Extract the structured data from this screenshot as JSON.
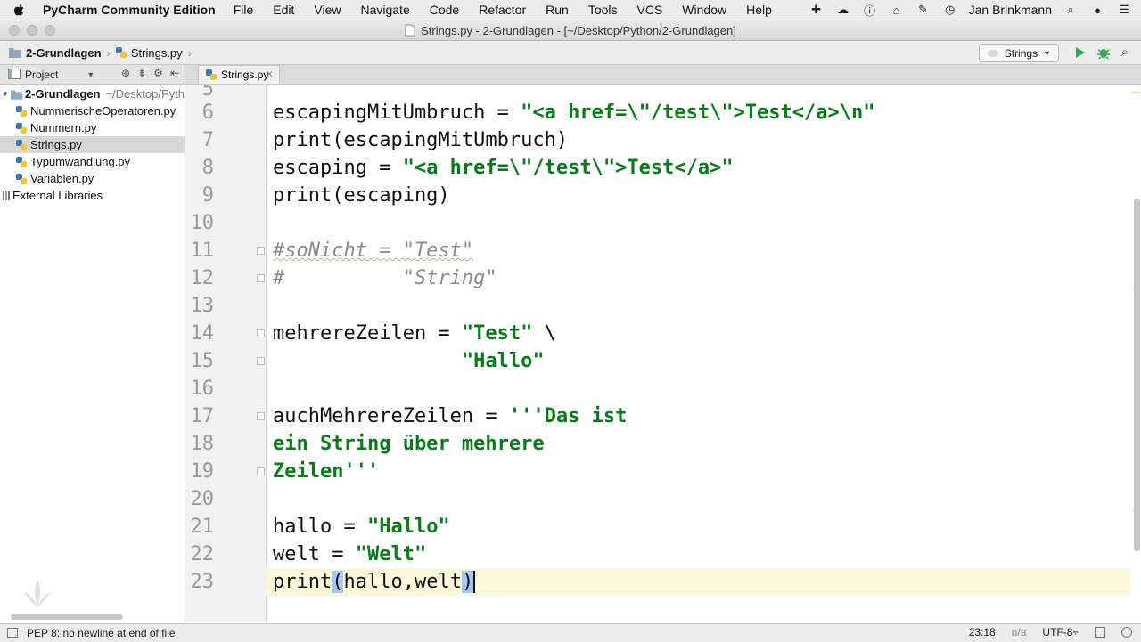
{
  "menubar": {
    "app_name": "PyCharm Community Edition",
    "menus": [
      "File",
      "Edit",
      "View",
      "Navigate",
      "Code",
      "Refactor",
      "Run",
      "Tools",
      "VCS",
      "Window",
      "Help"
    ],
    "user": "Jan Brinkmann"
  },
  "window": {
    "title": "Strings.py - 2-Grundlagen - [~/Desktop/Python/2-Grundlagen]"
  },
  "navbar": {
    "breadcrumbs": [
      "2-Grundlagen",
      "Strings.py"
    ],
    "run_config": "Strings"
  },
  "project_panel": {
    "label": "Project",
    "root": "2-Grundlagen",
    "root_path": "~/Desktop/Pyth",
    "files": [
      "NummerischeOperatoren.py",
      "Nummern.py",
      "Strings.py",
      "Typumwandlung.py",
      "Variablen.py"
    ],
    "external": "External Libraries"
  },
  "editor": {
    "tab_label": "Strings.py",
    "partial_line_number": "5",
    "lines": [
      {
        "n": "6",
        "a": "escapingMitUmbruch = ",
        "s": "\"<a href=\\\"/test\\\">Test</a>\\n\""
      },
      {
        "n": "7",
        "a": "print(escapingMitUmbruch)"
      },
      {
        "n": "8",
        "a": "escaping = ",
        "s": "\"<a href=\\\"/test\\\">Test</a>\""
      },
      {
        "n": "9",
        "a": "print(escaping)"
      },
      {
        "n": "10"
      },
      {
        "n": "11",
        "c": "#soNicht = \"Test\""
      },
      {
        "n": "12",
        "c": "#          \"String\""
      },
      {
        "n": "13"
      },
      {
        "n": "14",
        "a": "mehrereZeilen = ",
        "s": "\"Test\"",
        "t": " \\"
      },
      {
        "n": "15",
        "a": "                ",
        "s": "\"Hallo\""
      },
      {
        "n": "16"
      },
      {
        "n": "17",
        "a": "auchMehrereZeilen = ",
        "s": "'''Das ist"
      },
      {
        "n": "18",
        "s": "ein String über mehrere"
      },
      {
        "n": "19",
        "s": "Zeilen'''"
      },
      {
        "n": "20"
      },
      {
        "n": "21",
        "a": "hallo = ",
        "s": "\"Hallo\""
      },
      {
        "n": "22",
        "a": "welt = ",
        "s": "\"Welt\""
      },
      {
        "n": "23",
        "a": "print",
        "b1": "(",
        "m": "hallo,welt",
        "b2": ")"
      }
    ]
  },
  "statusbar": {
    "message": "PEP 8: no newline at end of file",
    "position": "23:18",
    "na": "n/a",
    "encoding": "UTF-8÷"
  }
}
